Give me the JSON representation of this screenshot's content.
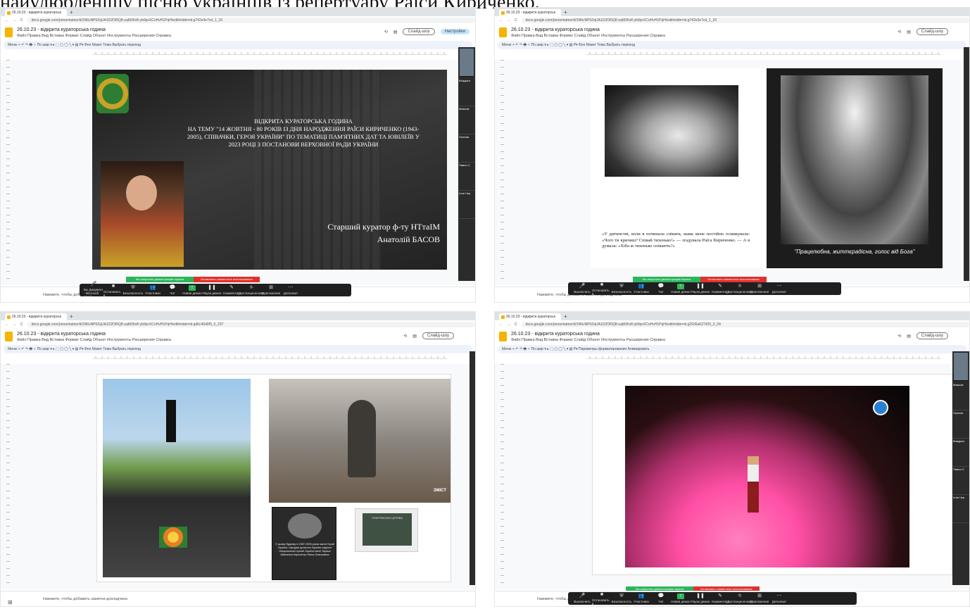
{
  "page_caption": "найулюбленішу пісню українців із репертуару Раїси Кириченко.",
  "browser": {
    "tab_title": "26.10.23 - відкрита кураторськ",
    "new_tab": "+",
    "urls": [
      "docs.google.com/presentation/d/1N6vNP0ZqUA1D2Ol5Q8-uqM3hv8-yb9pvXCoHvH1PqH/edit#slide=id.g742e3e7cd_1_16",
      "docs.google.com/presentation/d/1N6vNP0ZqUA1D2Ol5Q8-uqM3hv8-yb9pvXCoHvH1PqH/edit#slide=id.g742e3e7cd_1_33",
      "docs.google.com/presentation/d/1N6vNP0ZqUA1D2Ol5Q8-uqM3hv8-yb9pvXCoHvH1PqH/edit#slide=id.gd6c40d9f9_0_237",
      "docs.google.com/presentation/d/1N6vNP0ZqUA1D2Ol5Q8-uqM3hv8-yb9pvXCoHvH1PqH/edit#slide=id.g2936a627426_0_04"
    ]
  },
  "app": {
    "title": "26.10.23 - відкрита кураторська година",
    "menus": "Файл  Правка  Вид  Вставка  Формат  Слайд  Объект  Инструменты  Расширения  Справка",
    "slideshow": "Слайд-шоу",
    "share": "Настройки",
    "toolbar": "Меню   +  ↶  ↷  🖶  ⌖  По шир ▾   ▸  ⬚  ▢  ◯  ╲  ▾  ▤  P▾   Фон   Макет   Тема   Выбрать переход",
    "toolbar_video": "Меню   +  ↶  ↷  🖶  ⌖  По шир ▾   ▸  ⬚  ▢  ◯  ╲  ▾  ▤  P▾   Параметры форматирования   Анимировать",
    "notes": "Нажмите, чтобы добавить заметки докладчика"
  },
  "slide1": {
    "heading": "ВІДКРИТА КУРАТОРСЬКА ГОДИНА",
    "body": "НА ТЕМУ \"14 ЖОВТНЯ - 80 РОКІВ ІЗ ДНЯ НАРОДЖЕННЯ РАЇСИ КИРИЧЕНКО (1943-2005), СПІВАЧКИ, ГЕРОЯ УКРАЇНИ\" ПО ТЕМАТИЦІ ПАМ'ЯТНИХ ДАТ ТА ЮВІЛЕЇВ У 2023 РОЦІ З ПОСТАНОВИ ВЕРХОВНОЇ РАДИ УКРАЇНИ",
    "curator_line1": "Старший куратор ф-ту НТтаІМ",
    "curator_line2": "Анатолій БАСОВ"
  },
  "slide2": {
    "quote": "«У дитинстві, коли я починала співати, мама мене постійно осмикувала: «Чого ти кричиш? Співай тихенько!» — згадувала Раїса Кириченко. — А я думала: «Хіба ж тихенько співають?»",
    "quote_author": "згадувала Раїса Кириченко",
    "caption": "\"Працелюбна, життєрадісна, голос від Бога\""
  },
  "slide3": {
    "plaque_text": "У цьому будинку в 1987-2005 роках жила Герой України, народна артистка України лауреат Національної премії України імені Тараса Шевченка Кириченко Раїса Опанасівна",
    "watermark": "ЗМІСТ",
    "sign_text": "ПОКРОВСЬКА ЦЕРКВА"
  },
  "zoom": {
    "items": [
      "Выключить",
      "Остановить в",
      "Безопасность",
      "Участники",
      "Чат",
      "Новая демон",
      "Пауза демон",
      "Комментир",
      "Дистанционному",
      "Приложения",
      "Дополнит"
    ],
    "participants": "11",
    "share_on": "Вы запустили демонстрацию экрана",
    "stop_share": "Остановить совместное использование",
    "word_label": "Вы Документ - Microsoft Word"
  },
  "sidebar": {
    "names": [
      "Владисл",
      "Максим",
      "Полина",
      "Павло С",
      "Іл",
      "Ілля Чер"
    ]
  },
  "colors": {
    "slide1_bg": "#2a2a2a",
    "slide2_right_bg": "#1c1c1c",
    "share_green": "#2db55d",
    "stop_red": "#e0312c",
    "stage_pink": "#ff4fa5"
  }
}
